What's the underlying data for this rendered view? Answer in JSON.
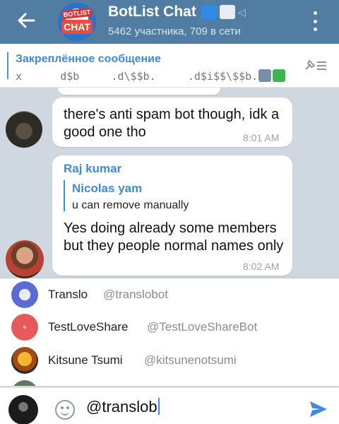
{
  "header": {
    "title": "BotList Chat",
    "subtitle": "5462 участника, 709 в сети",
    "avatar_top": "BOTLIST",
    "avatar_bottom": "CHAT"
  },
  "pinned": {
    "title": "Закреплённое сообщение",
    "text": "x      d$b     .d\\$$b.     .d$i$$\\$$b."
  },
  "messages": [
    {
      "text": "there's anti spam bot though,  idk a good one tho",
      "time": "8:01 AM"
    },
    {
      "sender": "Raj kumar",
      "reply_name": "Nicolas yam",
      "reply_text": "u can remove manually",
      "text": "Yes doing already some members but they people normal names only",
      "time": "8:02 AM"
    }
  ],
  "suggestions": [
    {
      "name": "Translo",
      "username": "@translobot"
    },
    {
      "name": "TestLoveShare",
      "username": "@TestLoveShareBot"
    },
    {
      "name": "Kitsune Tsumi",
      "username": "@kitsunenotsumi"
    }
  ],
  "input": {
    "value": "@translob"
  },
  "colors": {
    "header": "#517da2",
    "accent": "#3f8ad6",
    "send": "#3d8be0"
  },
  "icons": [
    "back-arrow-icon",
    "more-icon",
    "pin-list-icon",
    "emoji-icon",
    "send-icon"
  ]
}
